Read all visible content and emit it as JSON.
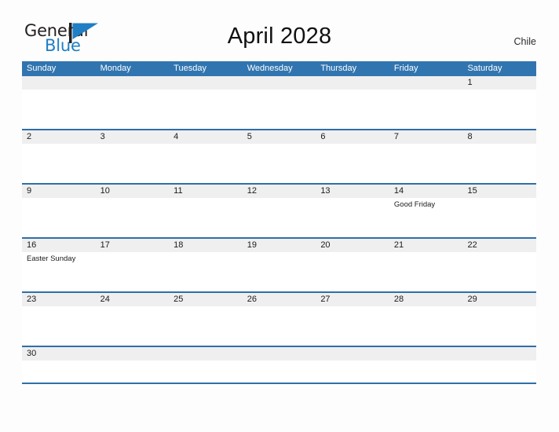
{
  "brand": {
    "name_part1": "General",
    "name_part2": "Blue",
    "flag_color": "#1f7ec4",
    "text_color": "#231f20"
  },
  "header": {
    "title": "April 2028",
    "region": "Chile"
  },
  "theme": {
    "header_blue": "#3175b0",
    "rule_blue": "#2f6fa8",
    "daynum_band": "#efefef",
    "page_background": "#fdfdfd"
  },
  "calendar": {
    "weekdays": [
      "Sunday",
      "Monday",
      "Tuesday",
      "Wednesday",
      "Thursday",
      "Friday",
      "Saturday"
    ],
    "weeks": [
      {
        "days": [
          {
            "num": "",
            "events": []
          },
          {
            "num": "",
            "events": []
          },
          {
            "num": "",
            "events": []
          },
          {
            "num": "",
            "events": []
          },
          {
            "num": "",
            "events": []
          },
          {
            "num": "",
            "events": []
          },
          {
            "num": "1",
            "events": []
          }
        ]
      },
      {
        "days": [
          {
            "num": "2",
            "events": []
          },
          {
            "num": "3",
            "events": []
          },
          {
            "num": "4",
            "events": []
          },
          {
            "num": "5",
            "events": []
          },
          {
            "num": "6",
            "events": []
          },
          {
            "num": "7",
            "events": []
          },
          {
            "num": "8",
            "events": []
          }
        ]
      },
      {
        "days": [
          {
            "num": "9",
            "events": []
          },
          {
            "num": "10",
            "events": []
          },
          {
            "num": "11",
            "events": []
          },
          {
            "num": "12",
            "events": []
          },
          {
            "num": "13",
            "events": []
          },
          {
            "num": "14",
            "events": [
              "Good Friday"
            ]
          },
          {
            "num": "15",
            "events": []
          }
        ]
      },
      {
        "days": [
          {
            "num": "16",
            "events": [
              "Easter Sunday"
            ]
          },
          {
            "num": "17",
            "events": []
          },
          {
            "num": "18",
            "events": []
          },
          {
            "num": "19",
            "events": []
          },
          {
            "num": "20",
            "events": []
          },
          {
            "num": "21",
            "events": []
          },
          {
            "num": "22",
            "events": []
          }
        ]
      },
      {
        "days": [
          {
            "num": "23",
            "events": []
          },
          {
            "num": "24",
            "events": []
          },
          {
            "num": "25",
            "events": []
          },
          {
            "num": "26",
            "events": []
          },
          {
            "num": "27",
            "events": []
          },
          {
            "num": "28",
            "events": []
          },
          {
            "num": "29",
            "events": []
          }
        ]
      },
      {
        "short": true,
        "days": [
          {
            "num": "30",
            "events": []
          },
          {
            "num": "",
            "events": []
          },
          {
            "num": "",
            "events": []
          },
          {
            "num": "",
            "events": []
          },
          {
            "num": "",
            "events": []
          },
          {
            "num": "",
            "events": []
          },
          {
            "num": "",
            "events": []
          }
        ]
      }
    ]
  }
}
